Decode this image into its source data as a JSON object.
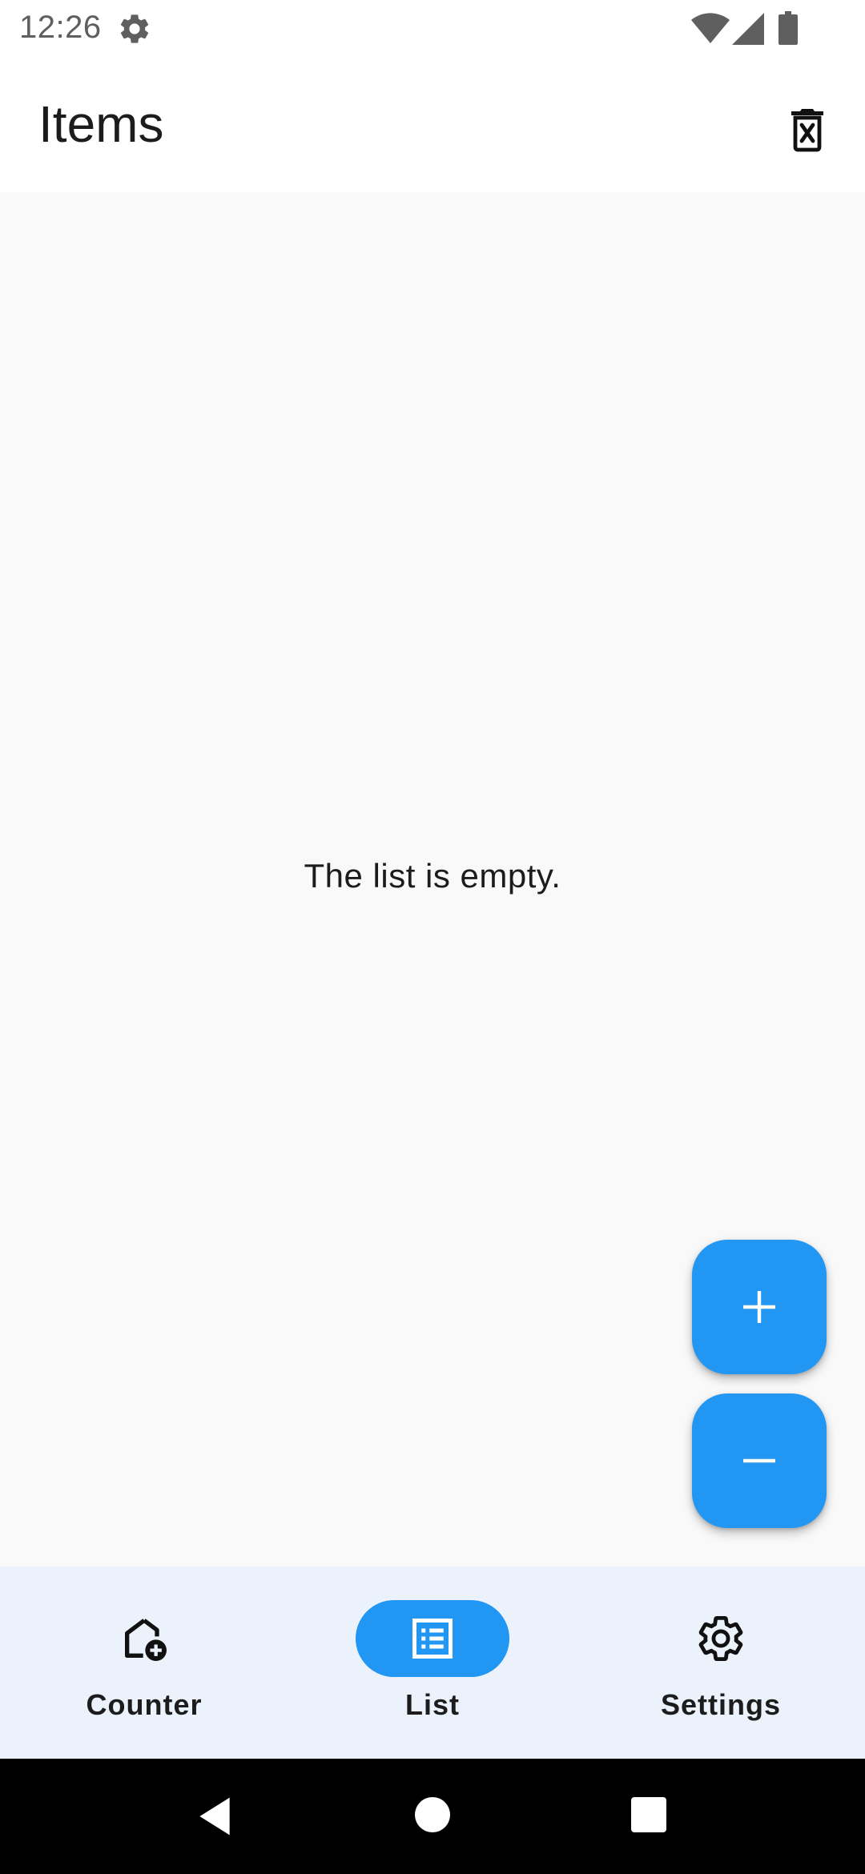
{
  "status_bar": {
    "time": "12:26",
    "icons": [
      "settings-gear-icon",
      "wifi-icon",
      "cell-signal-icon",
      "battery-icon"
    ]
  },
  "app_bar": {
    "title": "Items",
    "action_icon": "delete-all-icon"
  },
  "content": {
    "empty_message": "The list is empty."
  },
  "fabs": [
    {
      "icon": "plus-icon"
    },
    {
      "icon": "minus-icon"
    }
  ],
  "bottom_nav": {
    "items": [
      {
        "label": "Counter",
        "icon": "home-add-icon",
        "active": false
      },
      {
        "label": "List",
        "icon": "list-icon",
        "active": true
      },
      {
        "label": "Settings",
        "icon": "gear-icon",
        "active": false
      }
    ]
  },
  "system_nav": {
    "buttons": [
      "back-icon",
      "home-icon",
      "recents-icon"
    ]
  },
  "colors": {
    "accent": "#2196f3",
    "background": "#f9f9f9",
    "nav_background": "#ebf2fb",
    "text": "#1c1c1c"
  }
}
